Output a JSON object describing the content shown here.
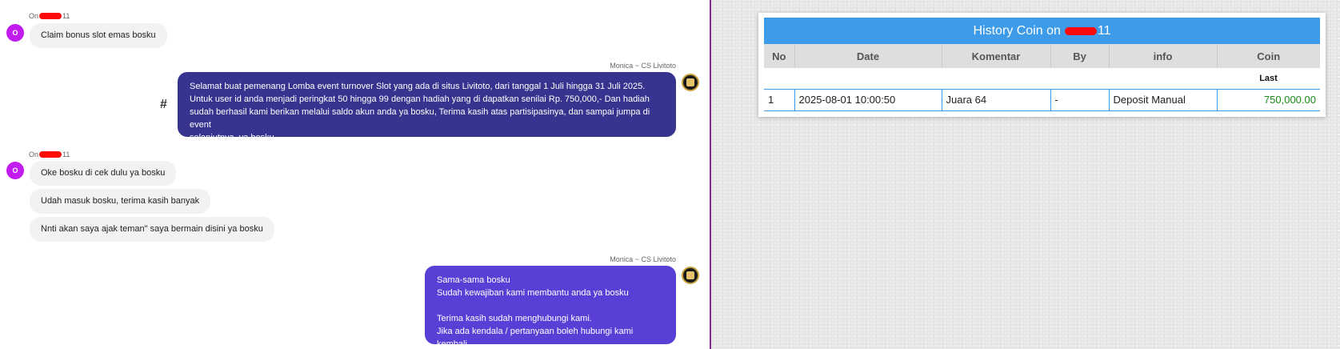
{
  "chat": {
    "user_initial": "O",
    "user_name_prefix": "On",
    "user_name_suffix": "11",
    "agent_name": "Monica ~ CS Livitoto",
    "messages_in_1": [
      "Claim bonus slot emas bosku"
    ],
    "messages_out_1": [
      "Selamat buat pemenang Lomba event turnover Slot yang ada di situs Livitoto, dari tanggal 1 Juli hingga 31 Juli 2025.",
      "Untuk user id anda menjadi peringkat 50 hingga 99 dengan hadiah yang di dapatkan senilai Rp. 750,000,- Dan hadiah",
      "sudah berhasil kami berikan melalui saldo akun anda ya bosku, Terima kasih atas partisipasinya, dan sampai jumpa di event",
      "selanjutnya, ya bosku"
    ],
    "hash_symbol": "#",
    "messages_in_2": [
      "Oke bosku di cek dulu ya bosku",
      "Udah masuk bosku, terima kasih banyak",
      "Nnti akan saya ajak teman\" saya bermain disini ya bosku"
    ],
    "messages_out_2": [
      "Sama-sama bosku",
      "Sudah kewajiban kami membantu anda ya bosku",
      "",
      "Terima kasih sudah menghubungi kami.",
      "Jika ada kendala / pertanyaan boleh hubungi kami kembali."
    ]
  },
  "history": {
    "title_prefix": "History Coin on",
    "title_suffix": "11",
    "columns": [
      "No",
      "Date",
      "Komentar",
      "By",
      "info",
      "Coin"
    ],
    "subheader_last": "Last",
    "rows": [
      {
        "no": "1",
        "date": "2025-08-01 10:00:50",
        "komentar": "Juara 64",
        "by": "-",
        "info": "Deposit Manual",
        "coin": "750,000.00"
      }
    ]
  },
  "colors": {
    "header_blue": "#3d9be9",
    "bubble_dark": "#36348e",
    "bubble_violet": "#5a3fd6",
    "avatar_purple": "#c21bf0",
    "coin_green": "#1a8a1a",
    "redaction_red": "#ff0a0a"
  }
}
